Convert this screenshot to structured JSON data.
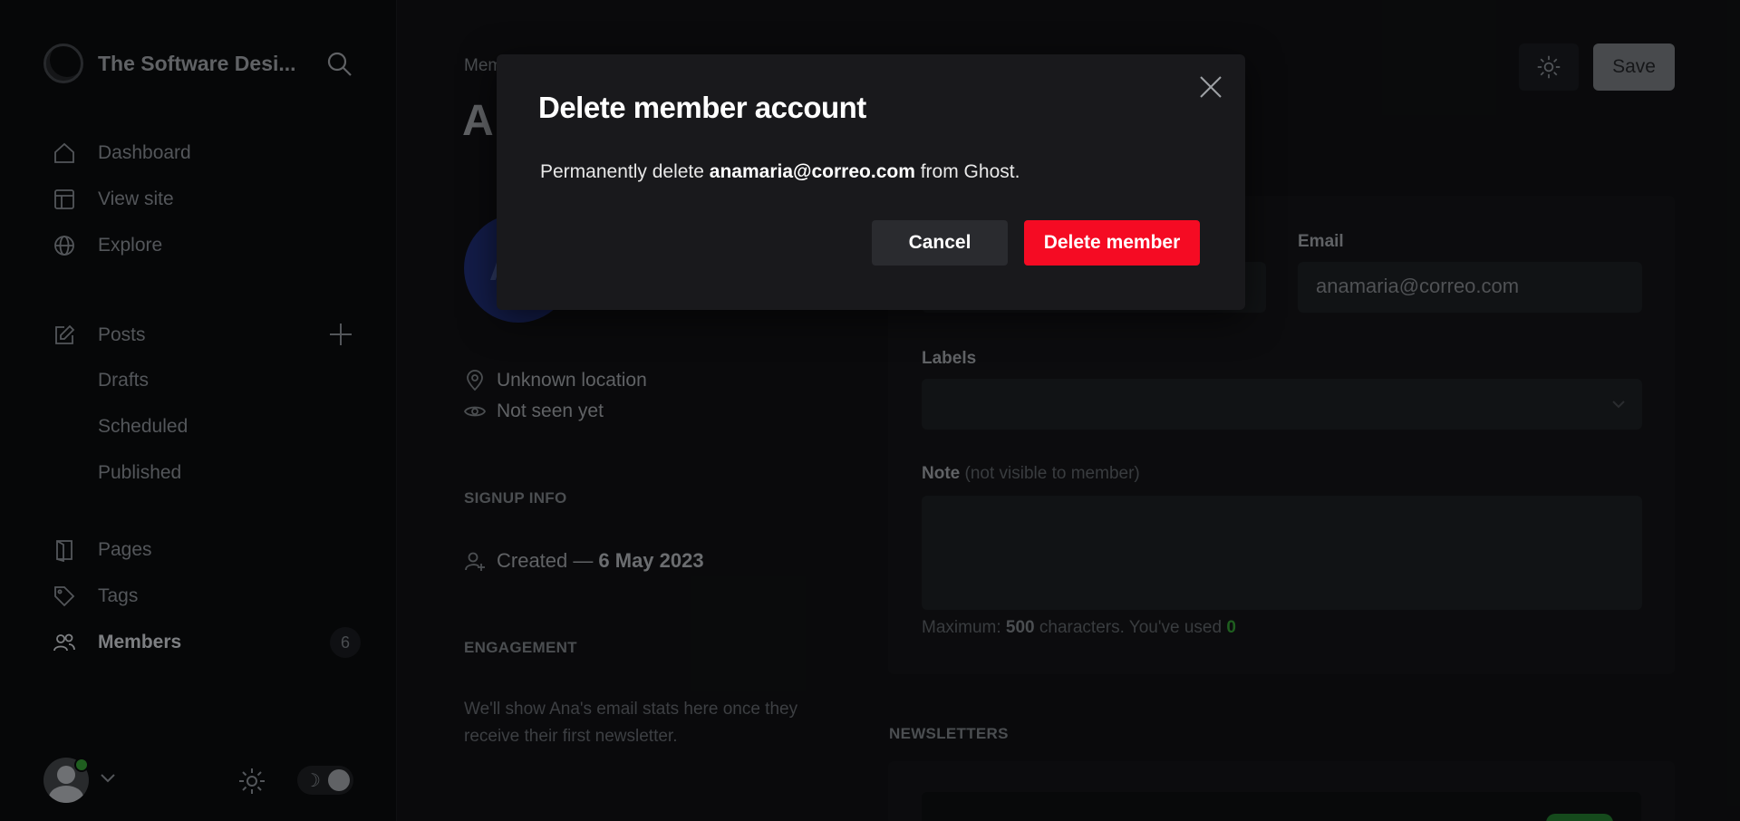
{
  "sidebar": {
    "brand_name": "The Software Desi...",
    "items": [
      {
        "label": "Dashboard",
        "icon": "home-icon"
      },
      {
        "label": "View site",
        "icon": "layout-icon"
      },
      {
        "label": "Explore",
        "icon": "globe-icon"
      },
      {
        "label": "Posts",
        "icon": "edit-icon"
      },
      {
        "label": "Drafts"
      },
      {
        "label": "Scheduled"
      },
      {
        "label": "Published"
      },
      {
        "label": "Pages",
        "icon": "pages-icon"
      },
      {
        "label": "Tags",
        "icon": "tag-icon"
      },
      {
        "label": "Members",
        "icon": "members-icon",
        "count": "6",
        "active": true
      }
    ],
    "theme_icon": "☽"
  },
  "header": {
    "breadcrumb": "Mem",
    "title_initial": "A",
    "save_label": "Save"
  },
  "profile": {
    "avatar_initial": "A",
    "location": "Unknown location",
    "last_seen": "Not seen yet"
  },
  "signup": {
    "heading": "SIGNUP INFO",
    "created_prefix": "Created —",
    "created_date": "6 May 2023"
  },
  "engagement": {
    "heading": "ENGAGEMENT",
    "text": "We'll show Ana's email stats here once they receive their first newsletter."
  },
  "form": {
    "email_label": "Email",
    "email_value": "anamaria@correo.com",
    "labels_label": "Labels",
    "note_label": "Note",
    "note_hint": "(not visible to member)",
    "counter_prefix": "Maximum:",
    "counter_max": "500",
    "counter_mid": "characters. You've used",
    "counter_used": "0"
  },
  "newsletters": {
    "heading": "NEWSLETTERS"
  },
  "modal": {
    "title": "Delete member account",
    "body_prefix": "Permanently delete",
    "body_email": "anamaria@correo.com",
    "body_suffix": "from Ghost.",
    "cancel_label": "Cancel",
    "delete_label": "Delete member"
  },
  "colors": {
    "danger": "#f50b23",
    "success": "#2e8b2e",
    "avatar_bg": "#1c2a6b"
  }
}
